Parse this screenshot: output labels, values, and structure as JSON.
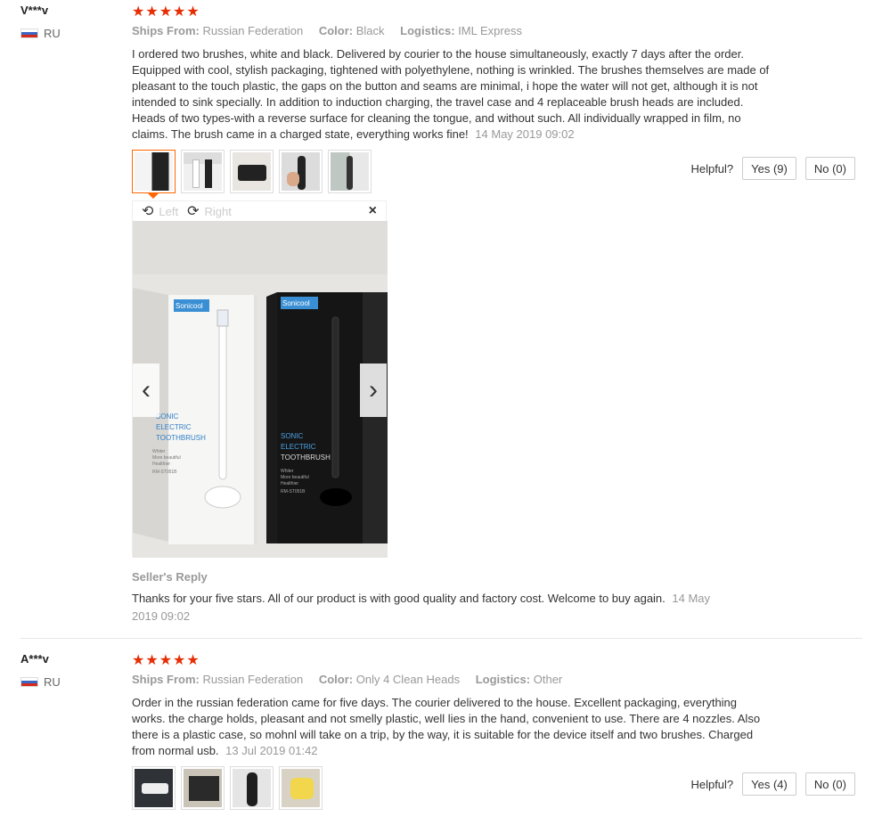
{
  "reviews": [
    {
      "user": "V***v",
      "country": "RU",
      "stars": "★★★★★",
      "ships_from_label": "Ships From:",
      "ships_from": "Russian Federation",
      "color_label": "Color:",
      "color": "Black",
      "logistics_label": "Logistics:",
      "logistics": "IML Express",
      "text": "I ordered two brushes, white and black. Delivered by courier to the house simultaneously, exactly 7 days after the order. Equipped with cool, stylish packaging, tightened with polyethylene, nothing is wrinkled. The brushes themselves are made of pleasant to the touch plastic, the gaps on the button and seams are minimal, i hope the water will not get, although it is not intended to sink specially. In addition to induction charging, the travel case and 4 replaceable brush heads are included. Heads of two types-with a reverse surface for cleaning the tongue, and without such. All individually wrapped in film, no claims. The brush came in a charged state, everything works fine!",
      "date": "14 May 2019 09:02",
      "helpful_label": "Helpful?",
      "yes_label": "Yes (9)",
      "no_label": "No (0)",
      "viewer": {
        "rotate_left": "Left",
        "rotate_right": "Right",
        "close": "×",
        "box_brand": "Sonicool",
        "box_line1": "SONIC",
        "box_line2": "ELECTRIC",
        "box_line3": "TOOTHBRUSH",
        "box_small1": "Whiter",
        "box_small2": "More beautiful",
        "box_small3": "Healthier",
        "box_model": "RM-ST051B"
      },
      "seller_reply_title": "Seller's Reply",
      "seller_reply": "Thanks for your five stars. All of our product is with good quality and factory cost. Welcome to buy again.",
      "seller_reply_date": "14 May 2019 09:02"
    },
    {
      "user": "A***v",
      "country": "RU",
      "stars": "★★★★★",
      "ships_from_label": "Ships From:",
      "ships_from": "Russian Federation",
      "color_label": "Color:",
      "color": "Only 4 Clean Heads",
      "logistics_label": "Logistics:",
      "logistics": "Other",
      "text": "Order in the russian federation came for five days. The courier delivered to the house. Excellent packaging, everything works. the charge holds, pleasant and not smelly plastic, well lies in the hand, convenient to use. There are 4 nozzles. Also there is a plastic case, so mohnl will take on a trip, by the way, it is suitable for the device itself and two brushes. Charged from normal usb.",
      "date": "13 Jul 2019 01:42",
      "helpful_label": "Helpful?",
      "yes_label": "Yes (4)",
      "no_label": "No (0)"
    }
  ],
  "colors": {
    "star": "#e62e04",
    "active_thumb": "#ff6600",
    "muted": "#999999"
  }
}
